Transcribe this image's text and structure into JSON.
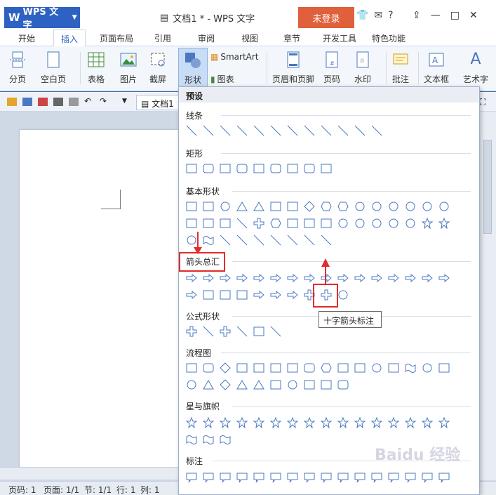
{
  "app": {
    "logo_text": "WPS 文字",
    "doc_title": "文档1 * - WPS 文字",
    "login": "未登录"
  },
  "window_controls": [
    "?",
    "—",
    "□",
    "✕"
  ],
  "tabs": [
    "开始",
    "插入",
    "页面布局",
    "引用",
    "审阅",
    "视图",
    "章节",
    "开发工具",
    "特色功能"
  ],
  "ribbon": {
    "page_break": "分页",
    "blank_page": "空白页",
    "table": "表格",
    "picture": "图片",
    "screenshot": "截屏",
    "shape": "形状",
    "smartart": "SmartArt",
    "chart": "图表",
    "header_footer": "页眉和页脚",
    "page_number": "页码",
    "watermark": "水印",
    "comment": "批注",
    "textbox": "文本框",
    "wordart": "艺术字"
  },
  "doc_tab": "文档1",
  "dropdown": {
    "header": "预设",
    "sections": {
      "lines": "线条",
      "rect": "矩形",
      "basic": "基本形状",
      "arrows": "箭头总汇",
      "equation": "公式形状",
      "flowchart": "流程图",
      "stars": "星与旗帜",
      "callouts": "标注"
    },
    "tooltip": "十字箭头标注"
  },
  "status": {
    "page": "页码: 1",
    "pages": "页面: 1/1",
    "section": "节: 1/1",
    "row": "行: 1",
    "col": "列: 1"
  },
  "watermark": "Baidu 经验",
  "colors": {
    "accent": "#2e62c2",
    "login": "#e0603c",
    "highlight": "#e02c2c"
  }
}
